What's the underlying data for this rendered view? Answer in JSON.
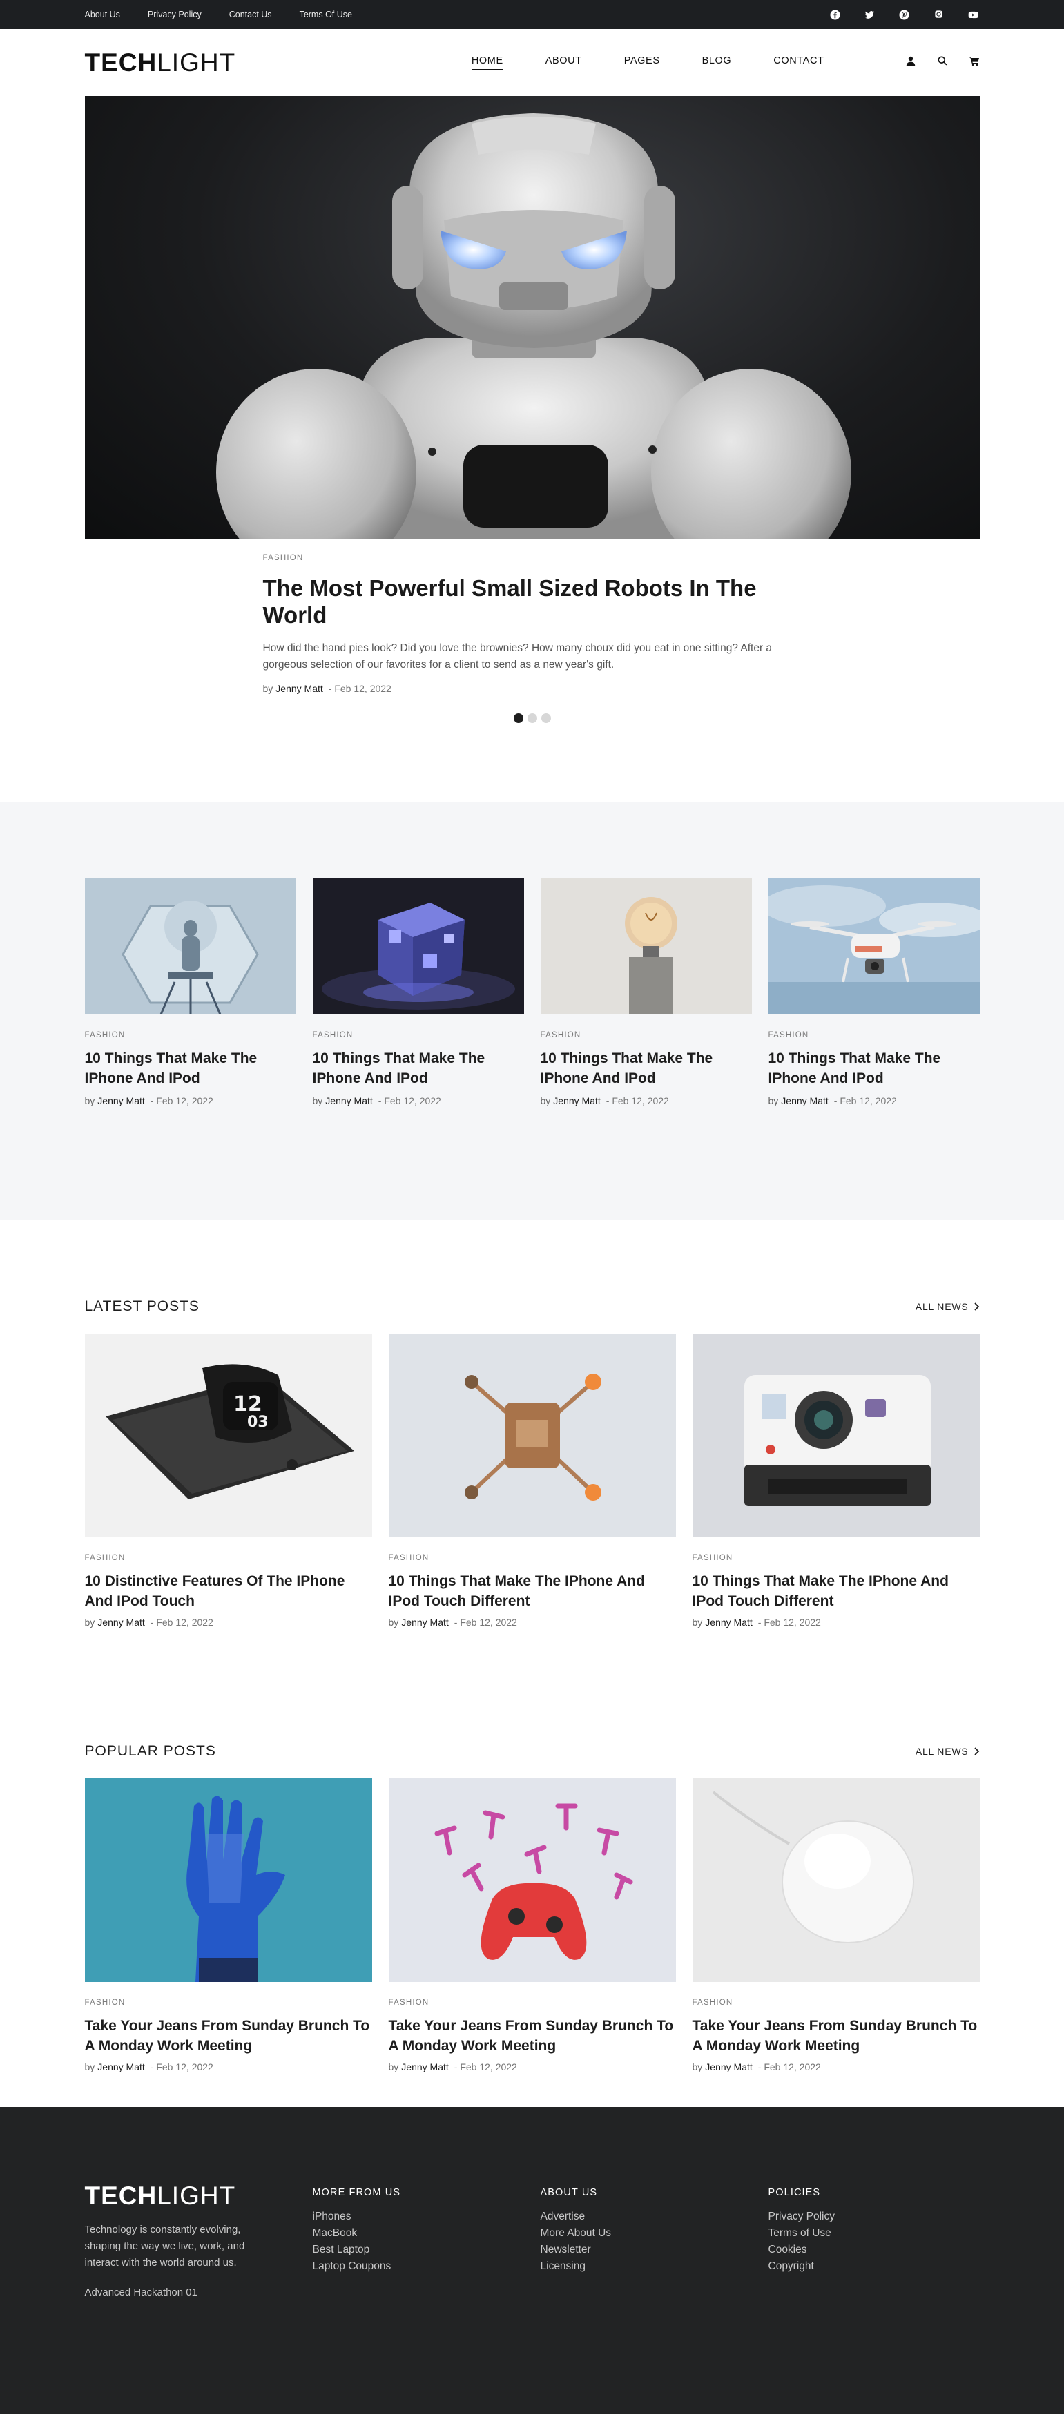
{
  "topbar": {
    "links": [
      "About Us",
      "Privacy Policy",
      "Contact Us",
      "Terms Of Use"
    ],
    "social_icons": [
      "facebook-icon",
      "twitter-icon",
      "pinterest-icon",
      "instagram-icon",
      "youtube-icon"
    ]
  },
  "header": {
    "logo_bold": "TECH",
    "logo_light": "LIGHT",
    "nav": [
      "HOME",
      "ABOUT",
      "PAGES",
      "BLOG",
      "CONTACT"
    ],
    "active_nav": "HOME",
    "icons": [
      "user-icon",
      "search-icon",
      "cart-icon"
    ]
  },
  "hero": {
    "category": "FASHION",
    "title": "The Most Powerful Small Sized Robots In The World",
    "description": "How did the hand pies look? Did you love the brownies? How many choux did you eat in one sitting? After a gorgeous selection of our favorites for a client to send as a new year's gift.",
    "by": "by",
    "author": "Jenny Matt",
    "date": "- Feb 12, 2022",
    "slides_total": 3,
    "slide_active": 1
  },
  "featured": [
    {
      "category": "FASHION",
      "title": "10 Things That Make The IPhone And IPod",
      "by": "by",
      "author": "Jenny Matt",
      "date": "- Feb 12, 2022"
    },
    {
      "category": "FASHION",
      "title": "10 Things That Make The IPhone And IPod",
      "by": "by",
      "author": "Jenny Matt",
      "date": "- Feb 12, 2022"
    },
    {
      "category": "FASHION",
      "title": "10 Things That Make The IPhone And IPod",
      "by": "by",
      "author": "Jenny Matt",
      "date": "- Feb 12, 2022"
    },
    {
      "category": "FASHION",
      "title": "10 Things That Make The IPhone And IPod",
      "by": "by",
      "author": "Jenny Matt",
      "date": "- Feb 12, 2022"
    }
  ],
  "latest": {
    "heading": "LATEST POSTS",
    "all_news": "ALL NEWS",
    "posts": [
      {
        "category": "FASHION",
        "title": "10 Distinctive Features Of The IPhone And IPod Touch",
        "by": "by",
        "author": "Jenny Matt",
        "date": "- Feb 12, 2022"
      },
      {
        "category": "FASHION",
        "title": "10 Things That Make The IPhone And IPod Touch Different",
        "by": "by",
        "author": "Jenny Matt",
        "date": "- Feb 12, 2022"
      },
      {
        "category": "FASHION",
        "title": "10 Things That Make The IPhone And IPod Touch Different",
        "by": "by",
        "author": "Jenny Matt",
        "date": "- Feb 12, 2022"
      }
    ]
  },
  "popular": {
    "heading": "POPULAR POSTS",
    "all_news": "ALL NEWS",
    "posts": [
      {
        "category": "FASHION",
        "title": "Take Your Jeans From Sunday Brunch To A Monday Work Meeting",
        "by": "by",
        "author": "Jenny Matt",
        "date": "- Feb 12, 2022"
      },
      {
        "category": "FASHION",
        "title": "Take Your Jeans From Sunday Brunch To A Monday Work Meeting",
        "by": "by",
        "author": "Jenny Matt",
        "date": "- Feb 12, 2022"
      },
      {
        "category": "FASHION",
        "title": "Take Your Jeans From Sunday Brunch To A Monday Work Meeting",
        "by": "by",
        "author": "Jenny Matt",
        "date": "- Feb 12, 2022"
      }
    ]
  },
  "footer": {
    "logo_bold": "TECH",
    "logo_light": "LIGHT",
    "description": "Technology is constantly evolving, shaping the way we live, work, and interact with the world around us.",
    "small": "Advanced Hackathon 01",
    "columns": [
      {
        "heading": "MORE FROM US",
        "links": [
          "iPhones",
          "MacBook",
          "Best Laptop",
          "Laptop Coupons"
        ]
      },
      {
        "heading": "ABOUT US",
        "links": [
          "Advertise",
          "More About Us",
          "Newsletter",
          "Licensing"
        ]
      },
      {
        "heading": "POLICIES",
        "links": [
          "Privacy Policy",
          "Terms of Use",
          "Cookies",
          "Copyright"
        ]
      }
    ]
  },
  "colors": {
    "topbar_bg": "#1d1f22",
    "featured_bg": "#f5f6f8",
    "footer_bg": "#222324",
    "text": "#1e1e1e"
  }
}
